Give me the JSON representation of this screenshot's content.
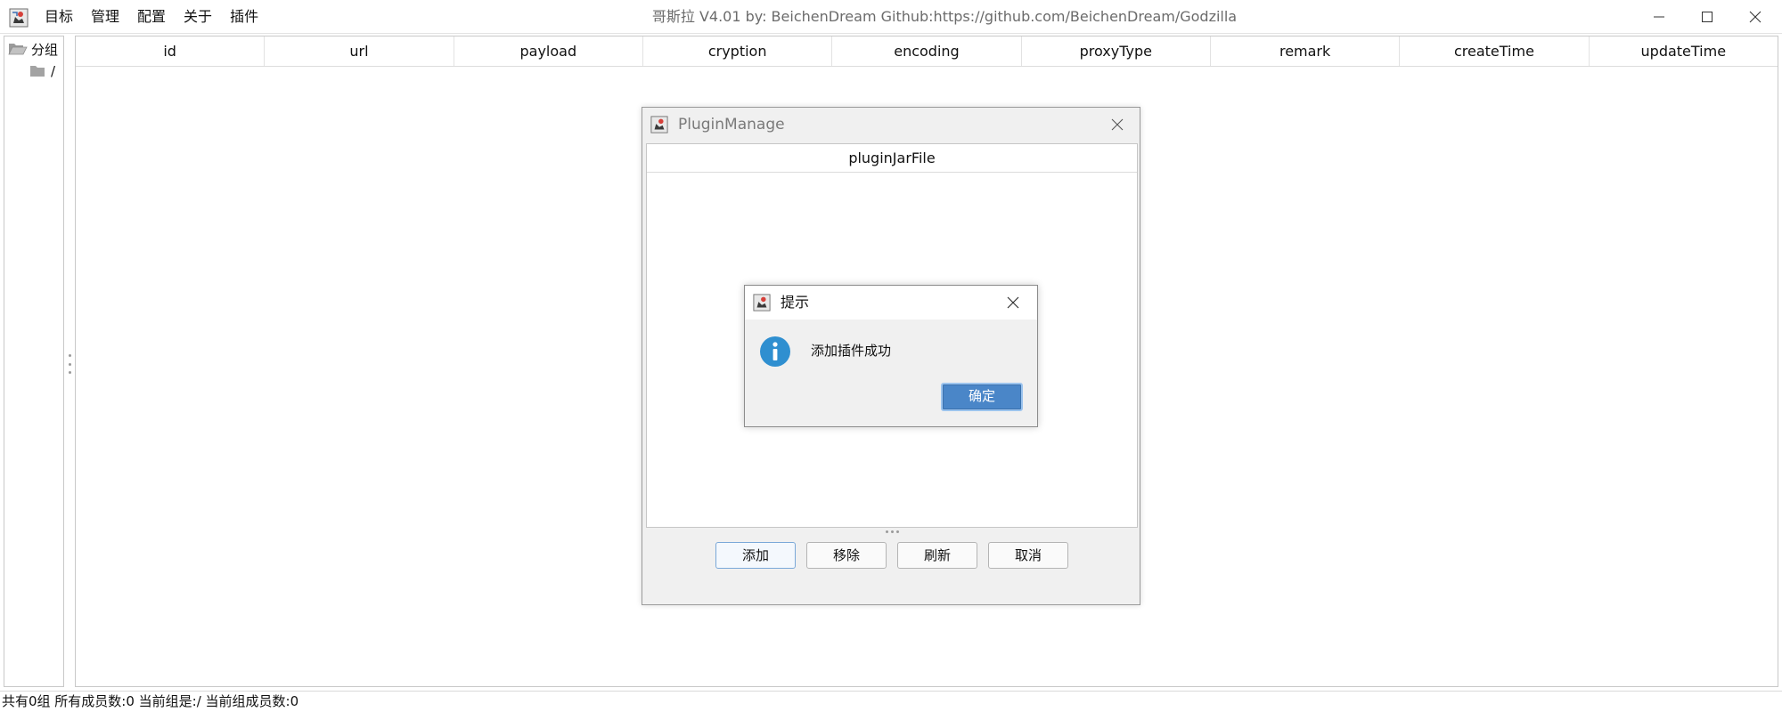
{
  "window": {
    "title": "哥斯拉   V4.01 by: BeichenDream Github:https://github.com/BeichenDream/Godzilla"
  },
  "menu": [
    {
      "label": "目标"
    },
    {
      "label": "管理"
    },
    {
      "label": "配置"
    },
    {
      "label": "关于"
    },
    {
      "label": "插件"
    }
  ],
  "tree": {
    "root_label": "分组",
    "child_label": "/"
  },
  "table": {
    "columns": [
      "id",
      "url",
      "payload",
      "cryption",
      "encoding",
      "proxyType",
      "remark",
      "createTime",
      "updateTime"
    ]
  },
  "status": {
    "text": "共有0组 所有成员数:0 当前组是:/ 当前组成员数:0"
  },
  "plugin_dialog": {
    "title": "PluginManage",
    "column": "pluginJarFile",
    "buttons": {
      "add": "添加",
      "remove": "移除",
      "refresh": "刷新",
      "cancel": "取消"
    }
  },
  "message_dialog": {
    "title": "提示",
    "message": "添加插件成功",
    "ok": "确定"
  },
  "icons": {
    "app": "java-app-icon",
    "folder_open": "folder-open-icon",
    "folder": "folder-icon",
    "info": "info-icon"
  },
  "colors": {
    "accent": "#4a86c8",
    "info": "#2f8fd0"
  }
}
